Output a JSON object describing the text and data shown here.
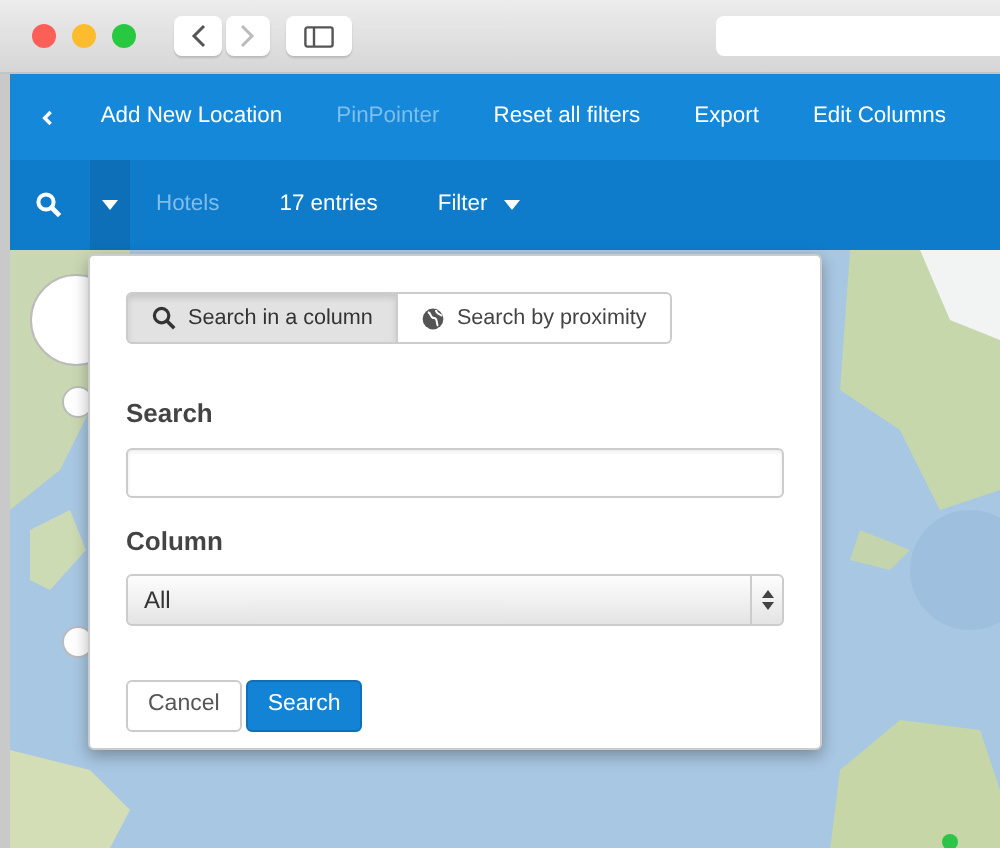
{
  "navbar": {
    "items": [
      {
        "label": "Add New Location",
        "disabled": false
      },
      {
        "label": "PinPointer",
        "disabled": true
      },
      {
        "label": "Reset all filters",
        "disabled": false
      },
      {
        "label": "Export",
        "disabled": false
      },
      {
        "label": "Edit Columns",
        "disabled": false
      }
    ]
  },
  "subbar": {
    "search_menu_expanded": true,
    "dataset": {
      "label": "Hotels",
      "disabled": true
    },
    "count": "17 entries",
    "filter": "Filter"
  },
  "popup": {
    "tabs": [
      {
        "label": "Search in a column",
        "selected": true
      },
      {
        "label": "Search by proximity",
        "selected": false
      }
    ],
    "search_label": "Search",
    "column_label": "Column",
    "column_value": "All",
    "buttons": [
      {
        "label": "Cancel",
        "kind": "default"
      },
      {
        "label": "Search",
        "kind": "primary"
      }
    ]
  }
}
